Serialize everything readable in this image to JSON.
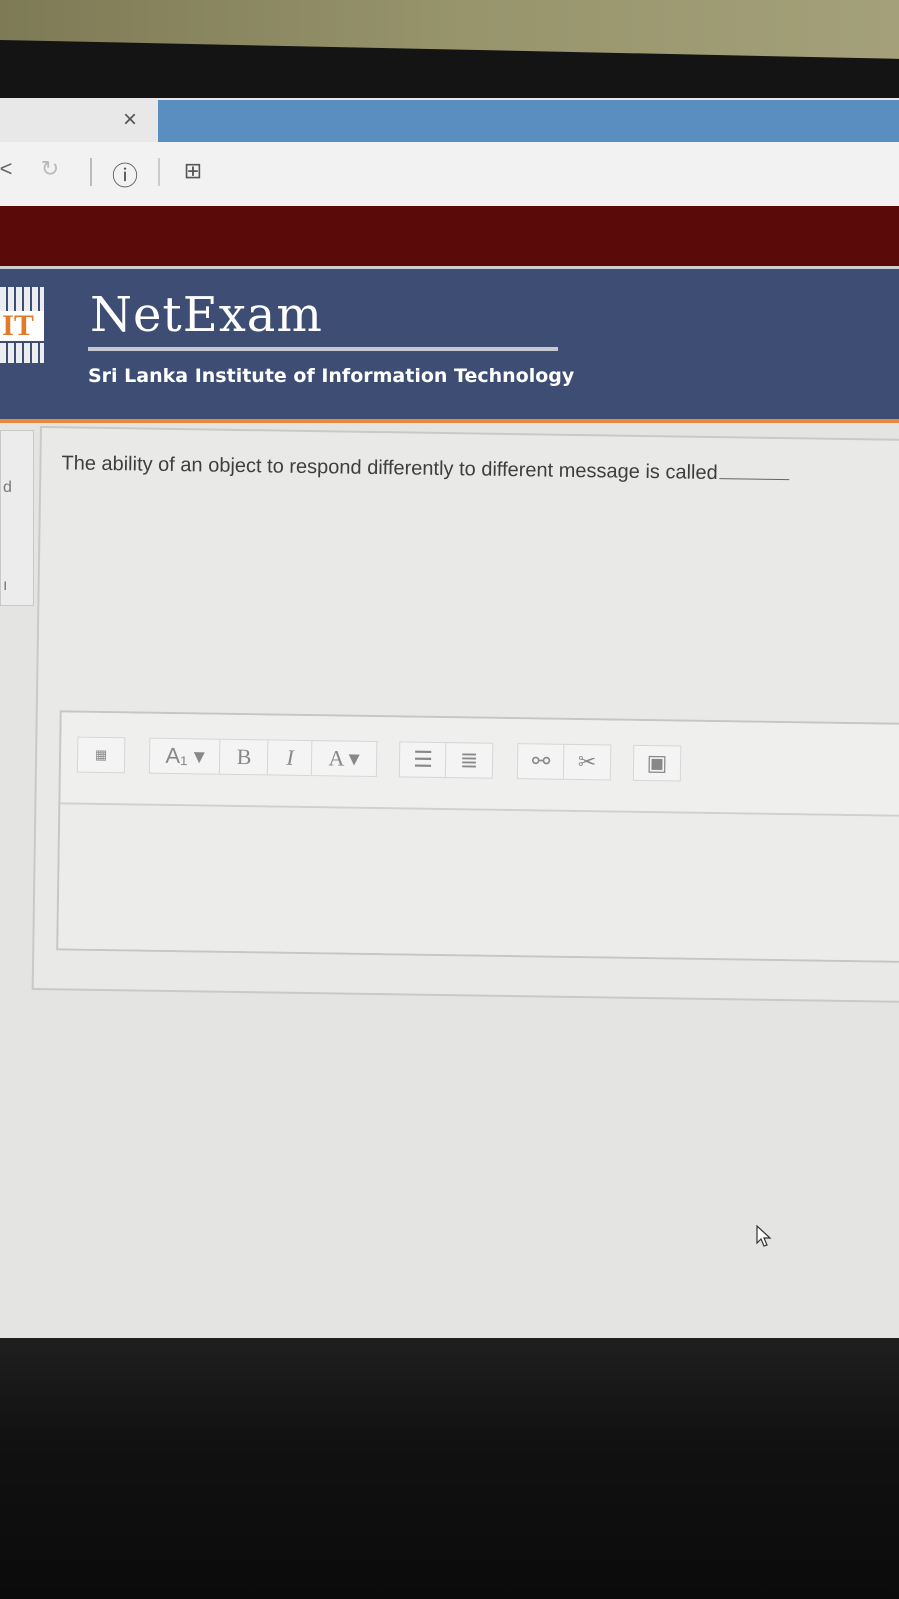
{
  "browser": {
    "tab_close_glyph": "×",
    "reload_glyph": "↻",
    "back_glyph": "<",
    "info_glyph": "ⓘ",
    "bookmark_glyph": "⊞"
  },
  "site": {
    "brand": "NetExam",
    "logo_text": "IT",
    "institute": "Sri Lanka Institute of Information Technology"
  },
  "question": {
    "text": "The ability of an object to respond differently to different message is called"
  },
  "editor": {
    "toolbar": {
      "paragraph_style_label": "A₁",
      "bold_label": "B",
      "italic_label": "I",
      "font_color_label": "A",
      "dropdown_arrow": "▾"
    },
    "value": ""
  },
  "left_sliver": {
    "line1": "d",
    "line2": "ı"
  },
  "colors": {
    "banner": "#3d4d73",
    "maroon_bar": "#5a0a08",
    "accent_orange": "#e8883a",
    "tab_blue": "#5b8ec0"
  }
}
